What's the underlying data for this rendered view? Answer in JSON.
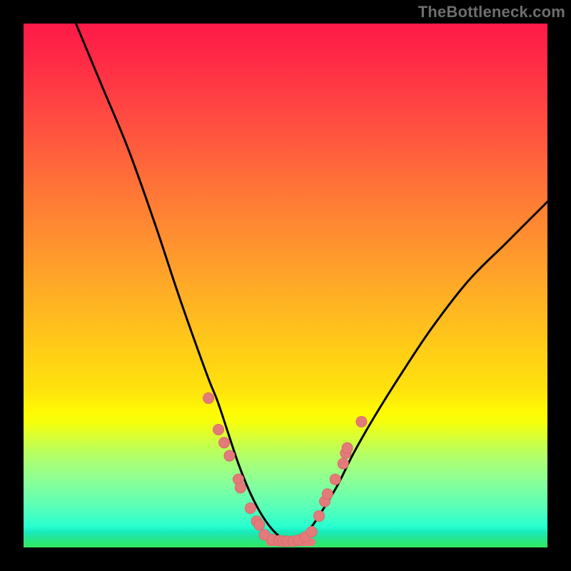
{
  "watermark": "TheBottleneck.com",
  "colors": {
    "curve_stroke": "#000000",
    "dot_fill": "#e47a7a",
    "dot_stroke": "#d86b6b"
  },
  "chart_data": {
    "type": "line",
    "title": "",
    "xlabel": "",
    "ylabel": "",
    "xlim": [
      0,
      100
    ],
    "ylim": [
      0,
      100
    ],
    "series": [
      {
        "name": "left-curve",
        "x": [
          10,
          15,
          20,
          25,
          30,
          35,
          37,
          39,
          41,
          43,
          45,
          47,
          49,
          51
        ],
        "values": [
          100,
          88,
          76,
          62,
          47,
          33,
          28,
          22,
          16,
          11,
          7,
          4,
          2,
          1
        ]
      },
      {
        "name": "right-curve",
        "x": [
          51,
          53,
          55,
          57,
          60,
          63,
          67,
          72,
          78,
          85,
          92,
          100
        ],
        "values": [
          1,
          2,
          4,
          7,
          12,
          18,
          25,
          33,
          42,
          51,
          58,
          66
        ]
      }
    ],
    "floor": {
      "x_range": [
        47,
        55
      ],
      "value": 1
    },
    "dots_left": {
      "x": [
        35.3,
        37.2,
        38.3,
        39.3,
        41.0,
        41.4,
        43.3,
        44.5,
        45.0
      ],
      "values": [
        28.5,
        22.5,
        20.0,
        17.5,
        13.0,
        11.4,
        7.5,
        5.0,
        4.3
      ]
    },
    "dots_right": {
      "x": [
        56.4,
        57.5,
        58.0,
        59.5,
        61.0,
        61.5,
        61.8,
        64.5
      ],
      "values": [
        6.0,
        8.8,
        10.2,
        13.0,
        16.0,
        18.0,
        19.0,
        24.0
      ]
    },
    "dots_floor": {
      "x": [
        46.0,
        47.5,
        48.8,
        49.5,
        50.3,
        51.5,
        52.5,
        53.8,
        55.0
      ],
      "values": [
        2.4,
        1.5,
        1.3,
        1.2,
        1.2,
        1.2,
        1.4,
        2.0,
        3.0
      ]
    }
  }
}
